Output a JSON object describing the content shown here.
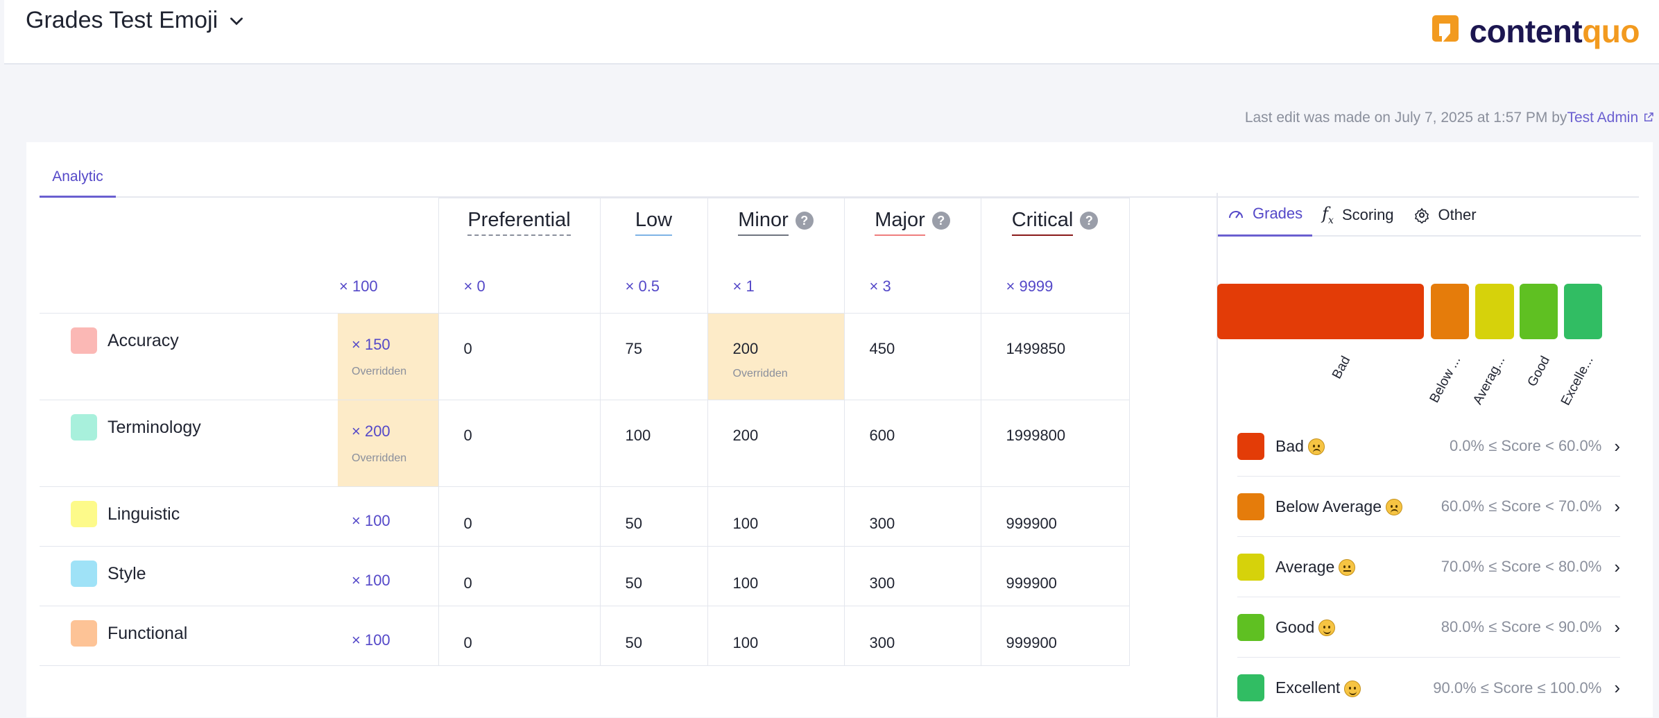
{
  "header": {
    "title": "Grades Test Emoji"
  },
  "logo": {
    "text_main": "content",
    "text_accent": "quo"
  },
  "last_edit": {
    "prefix": "Last edit was made on July 7, 2025 at 1:57 PM by",
    "user": "Test Admin"
  },
  "tabs": {
    "analytic": "Analytic"
  },
  "severities": [
    {
      "name": "Preferential",
      "multiplier": "× 0",
      "underline": "#8a8f9c",
      "dashed": true,
      "help": false
    },
    {
      "name": "Low",
      "multiplier": "× 0.5",
      "underline": "#7fb3e6",
      "dashed": false,
      "help": false
    },
    {
      "name": "Minor",
      "multiplier": "× 1",
      "underline": "#6f7580",
      "dashed": false,
      "help": true
    },
    {
      "name": "Major",
      "multiplier": "× 3",
      "underline": "#ef7d7d",
      "dashed": false,
      "help": true
    },
    {
      "name": "Critical",
      "multiplier": "× 9999",
      "underline": "#8a1a1a",
      "dashed": false,
      "help": true
    }
  ],
  "default_multiplier": "× 100",
  "overridden_label": "Overridden",
  "categories": [
    {
      "label": "Accuracy",
      "color": "#fbb8b5",
      "weight": "× 150",
      "overridden": true,
      "values": [
        "0",
        "75",
        "200",
        "450",
        "1499850"
      ],
      "overridden_cells": [
        2
      ]
    },
    {
      "label": "Terminology",
      "color": "#a8f0dc",
      "weight": "× 200",
      "overridden": true,
      "values": [
        "0",
        "100",
        "200",
        "600",
        "1999800"
      ],
      "overridden_cells": []
    },
    {
      "label": "Linguistic",
      "color": "#fdfa8a",
      "weight": "× 100",
      "overridden": false,
      "values": [
        "0",
        "50",
        "100",
        "300",
        "999900"
      ],
      "overridden_cells": []
    },
    {
      "label": "Style",
      "color": "#9fe2f7",
      "weight": "× 100",
      "overridden": false,
      "values": [
        "0",
        "50",
        "100",
        "300",
        "999900"
      ],
      "overridden_cells": []
    },
    {
      "label": "Functional",
      "color": "#fdc396",
      "weight": "× 100",
      "overridden": false,
      "values": [
        "0",
        "50",
        "100",
        "300",
        "999900"
      ],
      "overridden_cells": []
    }
  ],
  "side_tabs": {
    "grades": "Grades",
    "scoring": "Scoring",
    "other": "Other"
  },
  "grade_bar_labels": [
    "Bad",
    "Below ...",
    "Averag...",
    "Good",
    "Excelle..."
  ],
  "grades": [
    {
      "name": "Bad",
      "color": "#e33c07",
      "range": "0.0% ≤ Score < 60.0%",
      "emoji": "sad"
    },
    {
      "name": "Below Average",
      "color": "#e57c0b",
      "range": "60.0% ≤ Score < 70.0%",
      "emoji": "sad"
    },
    {
      "name": "Average",
      "color": "#d6d20b",
      "range": "70.0% ≤ Score < 80.0%",
      "emoji": "flat"
    },
    {
      "name": "Good",
      "color": "#5fc022",
      "range": "80.0% ≤ Score < 90.0%",
      "emoji": "happy"
    },
    {
      "name": "Excellent",
      "color": "#31bd63",
      "range": "90.0% ≤ Score ≤ 100.0%",
      "emoji": "happy"
    }
  ]
}
